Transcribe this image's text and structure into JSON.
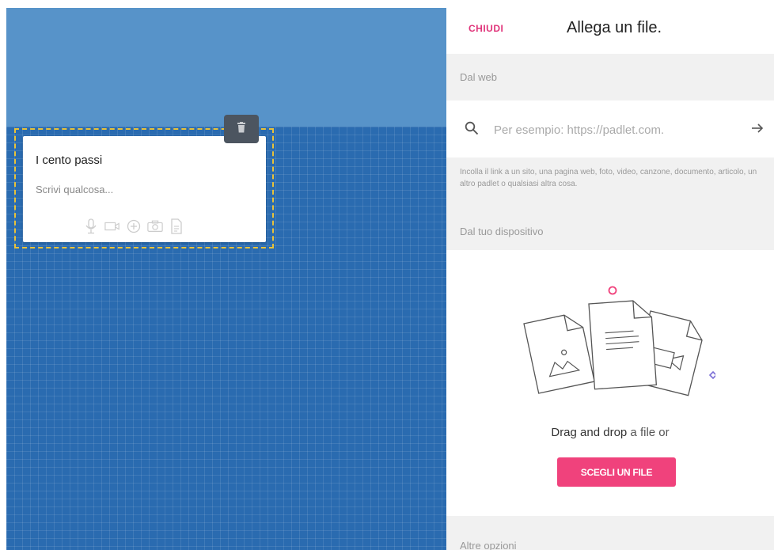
{
  "post": {
    "title": "I cento passi",
    "body_placeholder": "Scrivi qualcosa..."
  },
  "panel": {
    "close_label": "CHIUDI",
    "title": "Allega un file.",
    "web_section_label": "Dal web",
    "url_placeholder": "Per esempio: https://padlet.com.",
    "url_help": "Incolla il link a un sito, una pagina web, foto, video, canzone, documento, articolo, un altro padlet o qualsiasi altra cosa.",
    "device_section_label": "Dal tuo dispositivo",
    "drop_text_bold": "Drag and drop",
    "drop_text_rest": " a file or",
    "choose_file_label": "SCEGLI UN FILE",
    "other_options_label": "Altre opzioni"
  },
  "icons": [
    "trash-icon",
    "microphone-icon",
    "video-camera-icon",
    "add-circle-icon",
    "photo-camera-icon",
    "document-icon",
    "search-icon",
    "arrow-right-icon"
  ],
  "colors": {
    "accent": "#f0427c",
    "close": "#e0347a",
    "canvas_blue": "#2a6bb0",
    "canvas_top": "#5793c9",
    "outline": "#e8c23a"
  }
}
